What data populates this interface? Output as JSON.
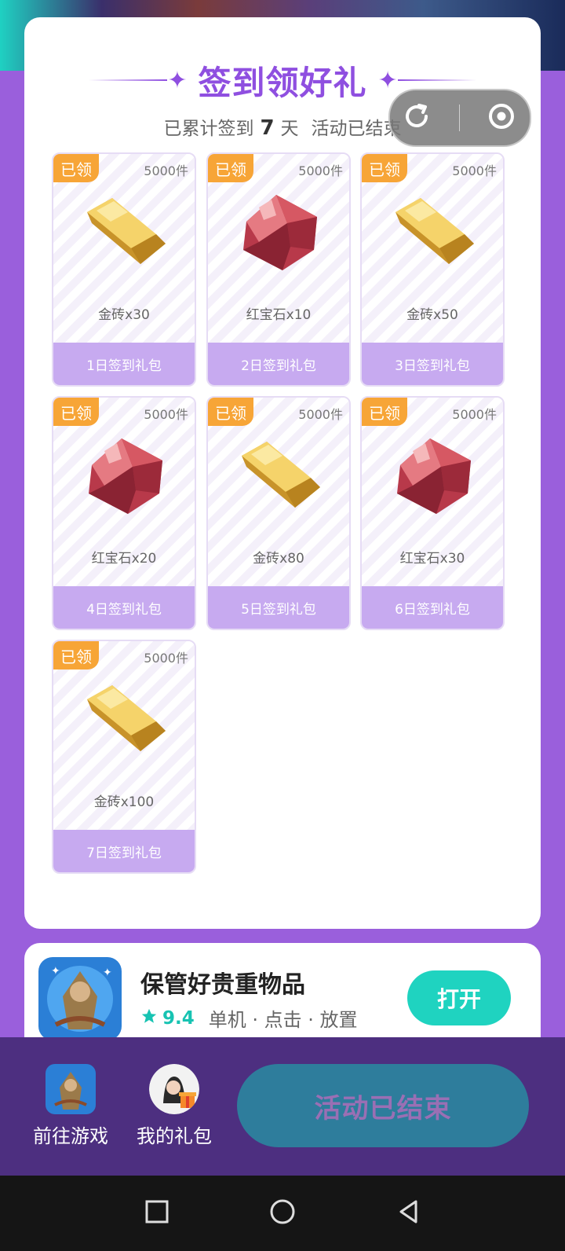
{
  "header": {
    "title": "签到领好礼",
    "subtitle_prefix": "已累计签到",
    "days": "7",
    "subtitle_suffix": "天",
    "status": "活动已结束"
  },
  "rewards": [
    {
      "badge": "已领",
      "stock": "5000件",
      "item": "金砖x30",
      "label": "1日签到礼包",
      "type": "gold"
    },
    {
      "badge": "已领",
      "stock": "5000件",
      "item": "红宝石x10",
      "label": "2日签到礼包",
      "type": "ruby"
    },
    {
      "badge": "已领",
      "stock": "5000件",
      "item": "金砖x50",
      "label": "3日签到礼包",
      "type": "gold"
    },
    {
      "badge": "已领",
      "stock": "5000件",
      "item": "红宝石x20",
      "label": "4日签到礼包",
      "type": "ruby"
    },
    {
      "badge": "已领",
      "stock": "5000件",
      "item": "金砖x80",
      "label": "5日签到礼包",
      "type": "gold"
    },
    {
      "badge": "已领",
      "stock": "5000件",
      "item": "红宝石x30",
      "label": "6日签到礼包",
      "type": "ruby"
    },
    {
      "badge": "已领",
      "stock": "5000件",
      "item": "金砖x100",
      "label": "7日签到礼包",
      "type": "gold"
    }
  ],
  "app": {
    "name": "保管好贵重物品",
    "rating": "9.4",
    "tags": "单机 · 点击 · 放置",
    "open_label": "打开"
  },
  "bottom": {
    "goto_game": "前往游戏",
    "my_gifts": "我的礼包",
    "cta": "活动已结束"
  },
  "colors": {
    "accent": "#8f4fe0",
    "badge": "#f7a537",
    "teal": "#1fd3c0",
    "footer": "#4d2f80"
  }
}
